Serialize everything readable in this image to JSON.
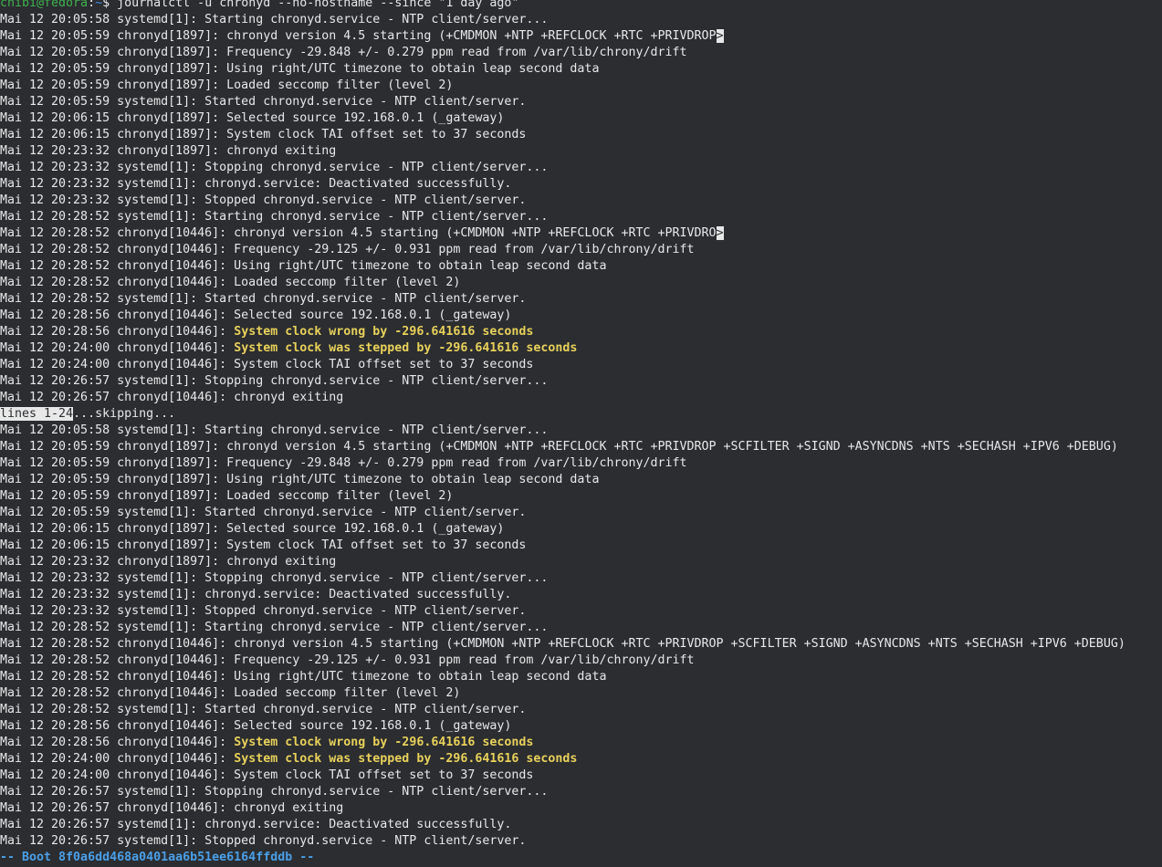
{
  "prompt": {
    "user_host": "chibi@fedora",
    "colon": ":",
    "path": "~",
    "symbol": "$ ",
    "command": "journalctl -u chronyd --no-hostname --since \"1 day ago\""
  },
  "pager_top": [
    {
      "t": "Mai 12 20:05:58 systemd[1]: Starting chronyd.service - NTP client/server..."
    },
    {
      "t": "Mai 12 20:05:59 chronyd[1897]: chronyd version 4.5 starting (+CMDMON +NTP +REFCLOCK +RTC +PRIVDROP",
      "trunc": ">"
    },
    {
      "t": "Mai 12 20:05:59 chronyd[1897]: Frequency -29.848 +/- 0.279 ppm read from /var/lib/chrony/drift"
    },
    {
      "t": "Mai 12 20:05:59 chronyd[1897]: Using right/UTC timezone to obtain leap second data"
    },
    {
      "t": "Mai 12 20:05:59 chronyd[1897]: Loaded seccomp filter (level 2)"
    },
    {
      "t": "Mai 12 20:05:59 systemd[1]: Started chronyd.service - NTP client/server."
    },
    {
      "t": "Mai 12 20:06:15 chronyd[1897]: Selected source 192.168.0.1 (_gateway)"
    },
    {
      "t": "Mai 12 20:06:15 chronyd[1897]: System clock TAI offset set to 37 seconds"
    },
    {
      "t": "Mai 12 20:23:32 chronyd[1897]: chronyd exiting"
    },
    {
      "t": "Mai 12 20:23:32 systemd[1]: Stopping chronyd.service - NTP client/server..."
    },
    {
      "t": "Mai 12 20:23:32 systemd[1]: chronyd.service: Deactivated successfully."
    },
    {
      "t": "Mai 12 20:23:32 systemd[1]: Stopped chronyd.service - NTP client/server."
    },
    {
      "t": "Mai 12 20:28:52 systemd[1]: Starting chronyd.service - NTP client/server..."
    },
    {
      "t": "Mai 12 20:28:52 chronyd[10446]: chronyd version 4.5 starting (+CMDMON +NTP +REFCLOCK +RTC +PRIVDRO",
      "trunc": ">"
    },
    {
      "t": "Mai 12 20:28:52 chronyd[10446]: Frequency -29.125 +/- 0.931 ppm read from /var/lib/chrony/drift"
    },
    {
      "t": "Mai 12 20:28:52 chronyd[10446]: Using right/UTC timezone to obtain leap second data"
    },
    {
      "t": "Mai 12 20:28:52 chronyd[10446]: Loaded seccomp filter (level 2)"
    },
    {
      "t": "Mai 12 20:28:52 systemd[1]: Started chronyd.service - NTP client/server."
    },
    {
      "t": "Mai 12 20:28:56 chronyd[10446]: Selected source 192.168.0.1 (_gateway)"
    },
    {
      "t": "Mai 12 20:28:56 chronyd[10446]: ",
      "w": "System clock wrong by -296.641616 seconds"
    },
    {
      "t": "Mai 12 20:24:00 chronyd[10446]: ",
      "w": "System clock was stepped by -296.641616 seconds"
    },
    {
      "t": "Mai 12 20:24:00 chronyd[10446]: System clock TAI offset set to 37 seconds"
    },
    {
      "t": "Mai 12 20:26:57 systemd[1]: Stopping chronyd.service - NTP client/server..."
    },
    {
      "t": "Mai 12 20:26:57 chronyd[10446]: chronyd exiting"
    }
  ],
  "pager_status": {
    "label": "lines 1-24",
    "tail": "...skipping..."
  },
  "log_bottom": [
    {
      "t": "Mai 12 20:05:58 systemd[1]: Starting chronyd.service - NTP client/server..."
    },
    {
      "t": "Mai 12 20:05:59 chronyd[1897]: chronyd version 4.5 starting (+CMDMON +NTP +REFCLOCK +RTC +PRIVDROP +SCFILTER +SIGND +ASYNCDNS +NTS +SECHASH +IPV6 +DEBUG)"
    },
    {
      "t": "Mai 12 20:05:59 chronyd[1897]: Frequency -29.848 +/- 0.279 ppm read from /var/lib/chrony/drift"
    },
    {
      "t": "Mai 12 20:05:59 chronyd[1897]: Using right/UTC timezone to obtain leap second data"
    },
    {
      "t": "Mai 12 20:05:59 chronyd[1897]: Loaded seccomp filter (level 2)"
    },
    {
      "t": "Mai 12 20:05:59 systemd[1]: Started chronyd.service - NTP client/server."
    },
    {
      "t": "Mai 12 20:06:15 chronyd[1897]: Selected source 192.168.0.1 (_gateway)"
    },
    {
      "t": "Mai 12 20:06:15 chronyd[1897]: System clock TAI offset set to 37 seconds"
    },
    {
      "t": "Mai 12 20:23:32 chronyd[1897]: chronyd exiting"
    },
    {
      "t": "Mai 12 20:23:32 systemd[1]: Stopping chronyd.service - NTP client/server..."
    },
    {
      "t": "Mai 12 20:23:32 systemd[1]: chronyd.service: Deactivated successfully."
    },
    {
      "t": "Mai 12 20:23:32 systemd[1]: Stopped chronyd.service - NTP client/server."
    },
    {
      "t": "Mai 12 20:28:52 systemd[1]: Starting chronyd.service - NTP client/server..."
    },
    {
      "t": "Mai 12 20:28:52 chronyd[10446]: chronyd version 4.5 starting (+CMDMON +NTP +REFCLOCK +RTC +PRIVDROP +SCFILTER +SIGND +ASYNCDNS +NTS +SECHASH +IPV6 +DEBUG)"
    },
    {
      "t": "Mai 12 20:28:52 chronyd[10446]: Frequency -29.125 +/- 0.931 ppm read from /var/lib/chrony/drift"
    },
    {
      "t": "Mai 12 20:28:52 chronyd[10446]: Using right/UTC timezone to obtain leap second data"
    },
    {
      "t": "Mai 12 20:28:52 chronyd[10446]: Loaded seccomp filter (level 2)"
    },
    {
      "t": "Mai 12 20:28:52 systemd[1]: Started chronyd.service - NTP client/server."
    },
    {
      "t": "Mai 12 20:28:56 chronyd[10446]: Selected source 192.168.0.1 (_gateway)"
    },
    {
      "t": "Mai 12 20:28:56 chronyd[10446]: ",
      "w": "System clock wrong by -296.641616 seconds"
    },
    {
      "t": "Mai 12 20:24:00 chronyd[10446]: ",
      "w": "System clock was stepped by -296.641616 seconds"
    },
    {
      "t": "Mai 12 20:24:00 chronyd[10446]: System clock TAI offset set to 37 seconds"
    },
    {
      "t": "Mai 12 20:26:57 systemd[1]: Stopping chronyd.service - NTP client/server..."
    },
    {
      "t": "Mai 12 20:26:57 chronyd[10446]: chronyd exiting"
    },
    {
      "t": "Mai 12 20:26:57 systemd[1]: chronyd.service: Deactivated successfully."
    },
    {
      "t": "Mai 12 20:26:57 systemd[1]: Stopped chronyd.service - NTP client/server."
    }
  ],
  "boot_marker": "-- Boot 8f0a6dd468a0401aa6b51ee6164ffddb --",
  "colors": {
    "background": "#2b2d30",
    "foreground": "#e8e8e8",
    "prompt_user": "#3fb24f",
    "prompt_path": "#3b8fe0",
    "warning": "#e8d15b",
    "boot_marker": "#4a9fe8"
  }
}
